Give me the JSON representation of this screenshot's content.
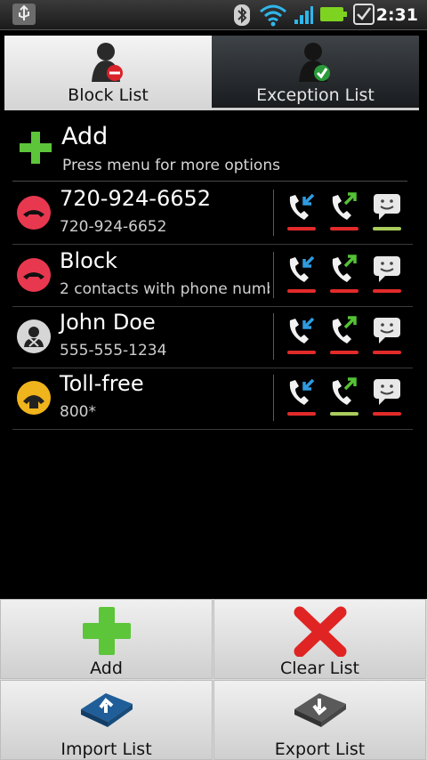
{
  "status": {
    "time": "2:31"
  },
  "tabs": [
    {
      "label": "Block List",
      "active": true
    },
    {
      "label": "Exception List",
      "active": false
    }
  ],
  "add_row": {
    "title": "Add",
    "subtitle": "Press menu for more options"
  },
  "list": [
    {
      "name": "720-924-6652",
      "detail": "720-924-6652",
      "icon": "block-phone-icon",
      "incoming": "red",
      "outgoing": "red",
      "sms": "green"
    },
    {
      "name": "Block",
      "detail": "2 contacts with phone numb",
      "icon": "block-phone-icon",
      "incoming": "red",
      "outgoing": "red",
      "sms": "red"
    },
    {
      "name": "John Doe",
      "detail": "555-555-1234",
      "icon": "contact-icon",
      "incoming": "red",
      "outgoing": "red",
      "sms": "red"
    },
    {
      "name": "Toll-free",
      "detail": "800*",
      "icon": "toll-free-icon",
      "incoming": "red",
      "outgoing": "green",
      "sms": "red"
    }
  ],
  "menu": [
    {
      "label": "Add",
      "icon": "plus-icon"
    },
    {
      "label": "Clear List",
      "icon": "clear-x-icon"
    },
    {
      "label": "Import List",
      "icon": "import-icon"
    },
    {
      "label": "Export List",
      "icon": "export-icon"
    }
  ],
  "colors": {
    "status_red": "#e22a2a",
    "status_green": "#a9cc5c",
    "accent_plus": "#5cc53a"
  }
}
